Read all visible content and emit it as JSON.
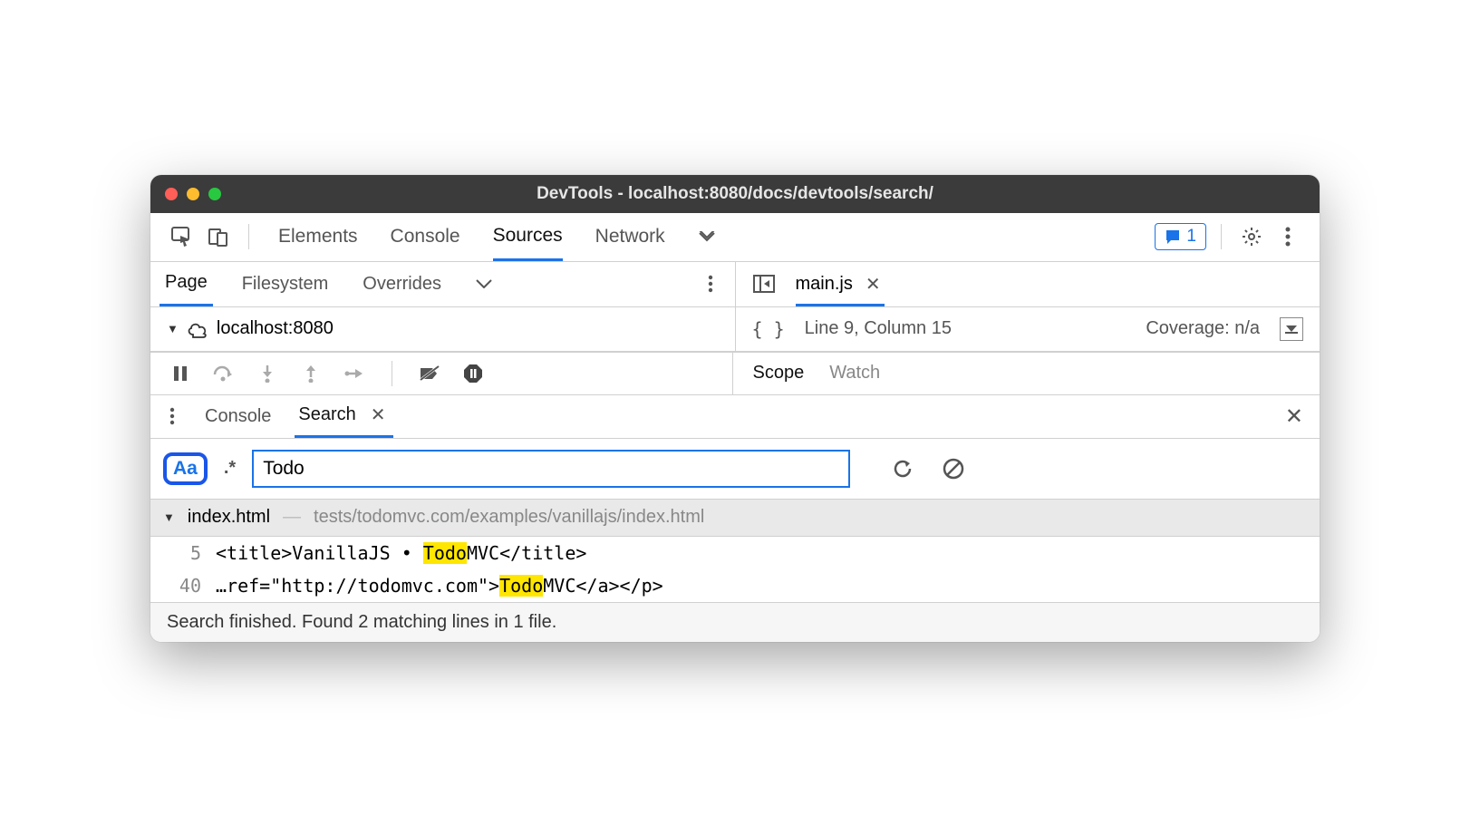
{
  "window": {
    "title": "DevTools - localhost:8080/docs/devtools/search/"
  },
  "toolbar": {
    "tabs": [
      "Elements",
      "Console",
      "Sources",
      "Network"
    ],
    "active_tab": "Sources",
    "badge_count": "1"
  },
  "left": {
    "sub_tabs": [
      "Page",
      "Filesystem",
      "Overrides"
    ],
    "active_sub_tab": "Page",
    "tree_host": "localhost:8080"
  },
  "right": {
    "file_tab": "main.js",
    "pretty_print": "{ }",
    "cursor": "Line 9, Column 15",
    "coverage": "Coverage: n/a"
  },
  "debugger": {
    "right_tabs": [
      "Scope",
      "Watch"
    ]
  },
  "drawer": {
    "tabs": [
      "Console",
      "Search"
    ],
    "active": "Search"
  },
  "search": {
    "case_label": "Aa",
    "regex_label": ".*",
    "query": "Todo"
  },
  "results": {
    "file": "index.html",
    "path": "tests/todomvc.com/examples/vanillajs/index.html",
    "lines": [
      {
        "num": "5",
        "pre": "<title>VanillaJS • ",
        "match": "Todo",
        "post": "MVC</title>"
      },
      {
        "num": "40",
        "pre": "…ref=\"http://todomvc.com\">",
        "match": "Todo",
        "post": "MVC</a></p>"
      }
    ]
  },
  "footer": {
    "status": "Search finished.  Found 2 matching lines in 1 file."
  }
}
